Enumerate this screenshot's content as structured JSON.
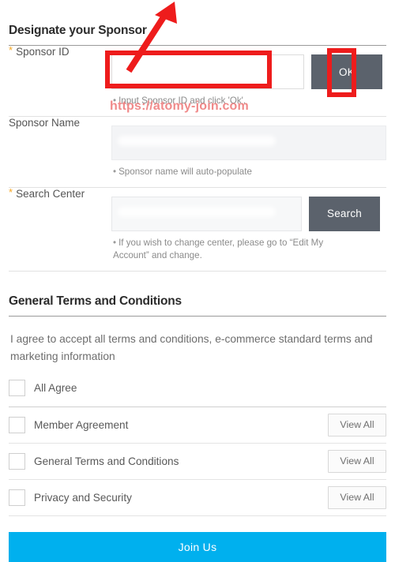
{
  "sponsor_section": {
    "title": "Designate your Sponsor",
    "rows": [
      {
        "label": "Sponsor ID",
        "required": true,
        "star": "*",
        "input_value": "",
        "input_placeholder": "",
        "button_label": "OK",
        "helper": "Input Sponsor ID and click 'Ok'.",
        "bullet": "•"
      },
      {
        "label": "Sponsor Name",
        "required": false,
        "star": "",
        "input_value": "",
        "input_placeholder": "",
        "button_label": "",
        "helper": "Sponsor name will auto-populate",
        "bullet": "•"
      },
      {
        "label": "Search Center",
        "required": true,
        "star": "*",
        "input_value": "",
        "input_placeholder": "",
        "button_label": "Search",
        "helper": "If you wish to change center, please go to “Edit My Account” and change.",
        "bullet": "•"
      }
    ]
  },
  "terms_section": {
    "title": "General Terms and Conditions",
    "intro": "I agree to accept all terms and conditions, e-commerce standard terms and marketing information",
    "all_agree": {
      "label": "All Agree",
      "checked": false
    },
    "items": [
      {
        "label": "Member Agreement",
        "checked": false,
        "action_label": "View All"
      },
      {
        "label": "General Terms and Conditions",
        "checked": false,
        "action_label": "View All"
      },
      {
        "label": "Privacy and Security",
        "checked": false,
        "action_label": "View All"
      }
    ]
  },
  "submit": {
    "label": "Join Us"
  },
  "annotation": {
    "watermark": "https://atomy-join.com",
    "highlight_color": "#ee1c1c",
    "arrow_color": "#ee1c1c"
  },
  "colors": {
    "accent": "#00b0ee",
    "button_dark": "#5b626c",
    "required_star": "#f5a623",
    "watermark": "#f08a8a"
  }
}
